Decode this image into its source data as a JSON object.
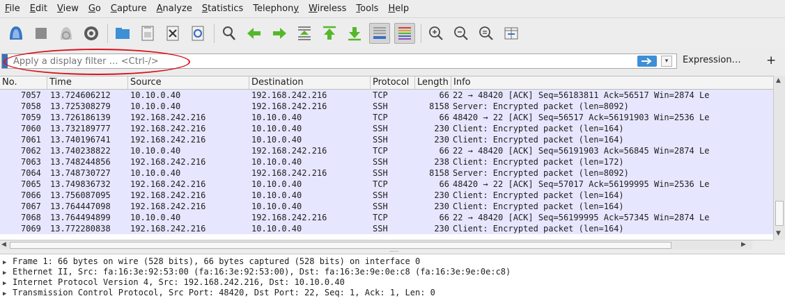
{
  "menu": [
    {
      "label": "File",
      "u": "F"
    },
    {
      "label": "Edit",
      "u": "E"
    },
    {
      "label": "View",
      "u": "V"
    },
    {
      "label": "Go",
      "u": "G"
    },
    {
      "label": "Capture",
      "u": "C"
    },
    {
      "label": "Analyze",
      "u": "A"
    },
    {
      "label": "Statistics",
      "u": "S"
    },
    {
      "label": "Telephony",
      "u": "y"
    },
    {
      "label": "Wireless",
      "u": "W"
    },
    {
      "label": "Tools",
      "u": "T"
    },
    {
      "label": "Help",
      "u": "H"
    }
  ],
  "toolbar": {
    "icons": [
      "start-capture-icon",
      "stop-capture-icon",
      "restart-capture-icon",
      "capture-options-icon",
      "open-file-icon",
      "save-file-icon",
      "close-file-icon",
      "reload-file-icon",
      "find-packet-icon",
      "go-back-icon",
      "go-forward-icon",
      "go-to-packet-icon",
      "go-first-icon",
      "go-last-icon",
      "auto-scroll-icon",
      "colorize-icon",
      "zoom-in-icon",
      "zoom-out-icon",
      "zoom-normal-icon",
      "resize-columns-icon"
    ]
  },
  "filter": {
    "placeholder": "Apply a display filter … <Ctrl-/>",
    "expression_label": "Expression…",
    "add_label": "+"
  },
  "columns": [
    "No.",
    "Time",
    "Source",
    "Destination",
    "Protocol",
    "Length",
    "Info"
  ],
  "packets": [
    {
      "no": "7057",
      "time": "13.724606212",
      "src": "10.10.0.40",
      "dst": "192.168.242.216",
      "proto": "TCP",
      "len": "66",
      "info": "22 → 48420 [ACK] Seq=56183811 Ack=56517 Win=2874 Le"
    },
    {
      "no": "7058",
      "time": "13.725308279",
      "src": "10.10.0.40",
      "dst": "192.168.242.216",
      "proto": "SSH",
      "len": "8158",
      "info": "Server: Encrypted packet (len=8092)"
    },
    {
      "no": "7059",
      "time": "13.726186139",
      "src": "192.168.242.216",
      "dst": "10.10.0.40",
      "proto": "TCP",
      "len": "66",
      "info": "48420 → 22 [ACK] Seq=56517 Ack=56191903 Win=2536 Le"
    },
    {
      "no": "7060",
      "time": "13.732189777",
      "src": "192.168.242.216",
      "dst": "10.10.0.40",
      "proto": "SSH",
      "len": "230",
      "info": "Client: Encrypted packet (len=164)"
    },
    {
      "no": "7061",
      "time": "13.740196741",
      "src": "192.168.242.216",
      "dst": "10.10.0.40",
      "proto": "SSH",
      "len": "230",
      "info": "Client: Encrypted packet (len=164)"
    },
    {
      "no": "7062",
      "time": "13.740238822",
      "src": "10.10.0.40",
      "dst": "192.168.242.216",
      "proto": "TCP",
      "len": "66",
      "info": "22 → 48420 [ACK] Seq=56191903 Ack=56845 Win=2874 Le"
    },
    {
      "no": "7063",
      "time": "13.748244856",
      "src": "192.168.242.216",
      "dst": "10.10.0.40",
      "proto": "SSH",
      "len": "238",
      "info": "Client: Encrypted packet (len=172)"
    },
    {
      "no": "7064",
      "time": "13.748730727",
      "src": "10.10.0.40",
      "dst": "192.168.242.216",
      "proto": "SSH",
      "len": "8158",
      "info": "Server: Encrypted packet (len=8092)"
    },
    {
      "no": "7065",
      "time": "13.749836732",
      "src": "192.168.242.216",
      "dst": "10.10.0.40",
      "proto": "TCP",
      "len": "66",
      "info": "48420 → 22 [ACK] Seq=57017 Ack=56199995 Win=2536 Le"
    },
    {
      "no": "7066",
      "time": "13.756087095",
      "src": "192.168.242.216",
      "dst": "10.10.0.40",
      "proto": "SSH",
      "len": "230",
      "info": "Client: Encrypted packet (len=164)"
    },
    {
      "no": "7067",
      "time": "13.764447098",
      "src": "192.168.242.216",
      "dst": "10.10.0.40",
      "proto": "SSH",
      "len": "230",
      "info": "Client: Encrypted packet (len=164)"
    },
    {
      "no": "7068",
      "time": "13.764494899",
      "src": "10.10.0.40",
      "dst": "192.168.242.216",
      "proto": "TCP",
      "len": "66",
      "info": "22 → 48420 [ACK] Seq=56199995 Ack=57345 Win=2874 Le"
    },
    {
      "no": "7069",
      "time": "13.772280838",
      "src": "192.168.242.216",
      "dst": "10.10.0.40",
      "proto": "SSH",
      "len": "230",
      "info": "Client: Encrypted packet (len=164)"
    }
  ],
  "details": [
    "Frame 1: 66 bytes on wire (528 bits), 66 bytes captured (528 bits) on interface 0",
    "Ethernet II, Src: fa:16:3e:92:53:00 (fa:16:3e:92:53:00), Dst: fa:16:3e:9e:0e:c8 (fa:16:3e:9e:0e:c8)",
    "Internet Protocol Version 4, Src: 192.168.242.216, Dst: 10.10.0.40",
    "Transmission Control Protocol, Src Port: 48420, Dst Port: 22, Seq: 1, Ack: 1, Len: 0"
  ],
  "colors": {
    "row_bg": "#e7e6ff",
    "highlight_ellipse": "#d9111a",
    "accent_blue": "#3d6fb4"
  }
}
